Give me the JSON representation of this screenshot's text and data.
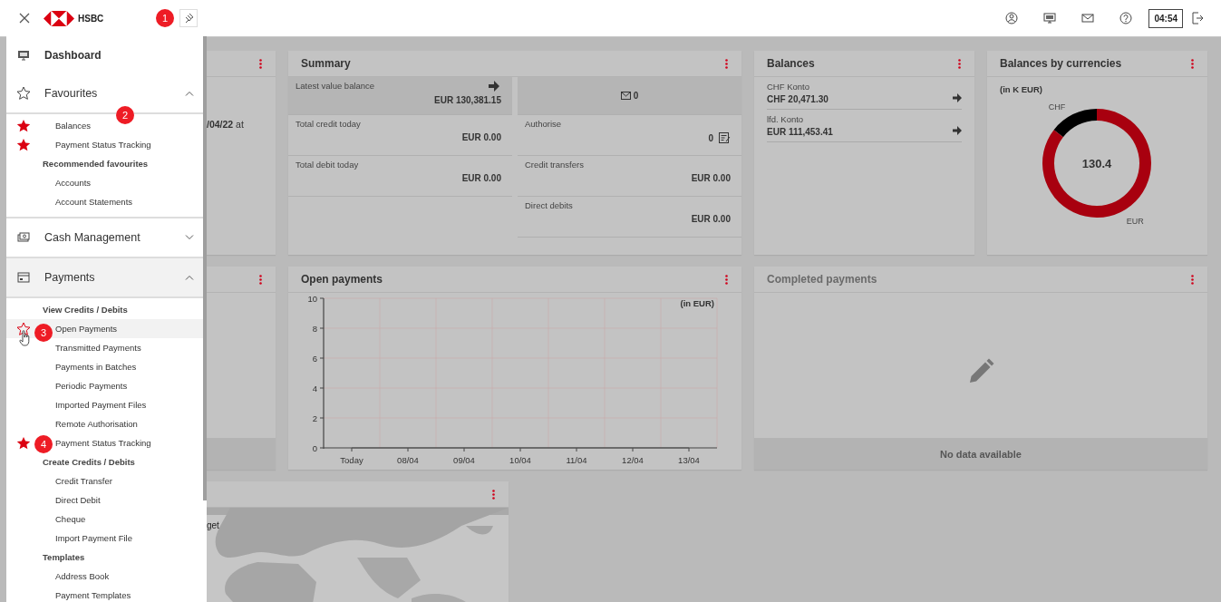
{
  "top_bar": {
    "logo_text": "HSBC",
    "timer": "04:54"
  },
  "sidebar": {
    "sections": [
      {
        "kind": "link",
        "label": "Dashboard"
      },
      {
        "kind": "group",
        "label": "Favourites",
        "expanded": true,
        "active": false,
        "entries": [
          {
            "kind": "item",
            "label": "Balances",
            "favourite": true,
            "hovered": false
          },
          {
            "kind": "item",
            "label": "Payment Status Tracking",
            "favourite": true,
            "hovered": false
          },
          {
            "kind": "heading",
            "label": "Recommended favourites"
          },
          {
            "kind": "item",
            "label": "Accounts",
            "favourite": false,
            "hovered": false
          },
          {
            "kind": "item",
            "label": "Account Statements",
            "favourite": false,
            "hovered": false
          }
        ]
      },
      {
        "kind": "group",
        "label": "Cash Management",
        "expanded": false,
        "active": false
      },
      {
        "kind": "group",
        "label": "Payments",
        "expanded": true,
        "active": true,
        "entries": [
          {
            "kind": "heading",
            "label": "View Credits / Debits"
          },
          {
            "kind": "item",
            "label": "Open Payments",
            "favourite": false,
            "hovered": true
          },
          {
            "kind": "item",
            "label": "Transmitted Payments",
            "favourite": false,
            "hovered": false
          },
          {
            "kind": "item",
            "label": "Payments in Batches",
            "favourite": false,
            "hovered": false
          },
          {
            "kind": "item",
            "label": "Periodic Payments",
            "favourite": false,
            "hovered": false
          },
          {
            "kind": "item",
            "label": "Imported Payment Files",
            "favourite": false,
            "hovered": false
          },
          {
            "kind": "item",
            "label": "Remote Authorisation",
            "favourite": false,
            "hovered": false
          },
          {
            "kind": "item",
            "label": "Payment Status Tracking",
            "favourite": true,
            "hovered": false
          },
          {
            "kind": "heading",
            "label": "Create Credits / Debits"
          },
          {
            "kind": "item",
            "label": "Credit Transfer",
            "favourite": false,
            "hovered": false
          },
          {
            "kind": "item",
            "label": "Direct Debit",
            "favourite": false,
            "hovered": false
          },
          {
            "kind": "item",
            "label": "Cheque",
            "favourite": false,
            "hovered": false
          },
          {
            "kind": "item",
            "label": "Import Payment File",
            "favourite": false,
            "hovered": false
          },
          {
            "kind": "heading",
            "label": "Templates"
          },
          {
            "kind": "item",
            "label": "Address Book",
            "favourite": false,
            "hovered": false
          },
          {
            "kind": "item",
            "label": "Payment Templates",
            "favourite": false,
            "hovered": false
          }
        ]
      }
    ]
  },
  "callouts": [
    {
      "label": "1"
    },
    {
      "label": "2"
    },
    {
      "label": "3"
    },
    {
      "label": "4"
    }
  ],
  "dashboard": {
    "cards": [
      {
        "kind": "note",
        "text": "**/04/22** at"
      },
      {
        "kind": "summary",
        "title": "Summary",
        "left": [
          {
            "label": "Latest value balance",
            "value": "EUR 130,381.15",
            "highlighted": true
          },
          {
            "label": "Total credit today",
            "value": "EUR 0.00",
            "highlighted": false
          },
          {
            "label": "Total debit today",
            "value": "EUR 0.00",
            "highlighted": false
          }
        ],
        "right": [
          {
            "kind": "messages",
            "value": "0",
            "highlighted": true
          },
          {
            "kind": "authorise",
            "label": "Authorise",
            "value": "0",
            "highlighted": false
          },
          {
            "kind": "amount",
            "label": "Credit transfers",
            "value": "EUR 0.00",
            "highlighted": false
          },
          {
            "kind": "amount",
            "label": "Direct debits",
            "value": "EUR 0.00",
            "highlighted": false
          }
        ]
      },
      {
        "kind": "balances",
        "title": "Balances",
        "accounts": [
          {
            "name": "CHF Konto",
            "amount": "CHF 20,471.30"
          },
          {
            "name": "lfd. Konto",
            "amount": "EUR 111,453.41"
          }
        ]
      },
      {
        "kind": "donut",
        "title": "Balances by currencies",
        "unit": "(in K EUR)",
        "chart_data": {
          "type": "donut",
          "categories": [
            "CHF",
            "EUR"
          ],
          "values": [
            14.5,
            85.5
          ],
          "annotations": [
            "130.4"
          ]
        }
      },
      {
        "kind": "footer_only"
      },
      {
        "kind": "line",
        "title": "Open payments",
        "unit": "(in EUR)",
        "chart_data": {
          "type": "line",
          "categories": [
            "Today",
            "08/04",
            "09/04",
            "10/04",
            "11/04",
            "12/04",
            "13/04"
          ],
          "ylim": [
            0,
            10
          ],
          "yticks": [
            0,
            2,
            4,
            6,
            8,
            10
          ],
          "grid": true,
          "values": [
            0,
            0,
            0,
            0,
            0,
            0,
            0
          ]
        }
      },
      {
        "kind": "empty",
        "title": "Completed payments",
        "message": "No data available"
      },
      {
        "kind": "map",
        "label": "get"
      }
    ]
  }
}
